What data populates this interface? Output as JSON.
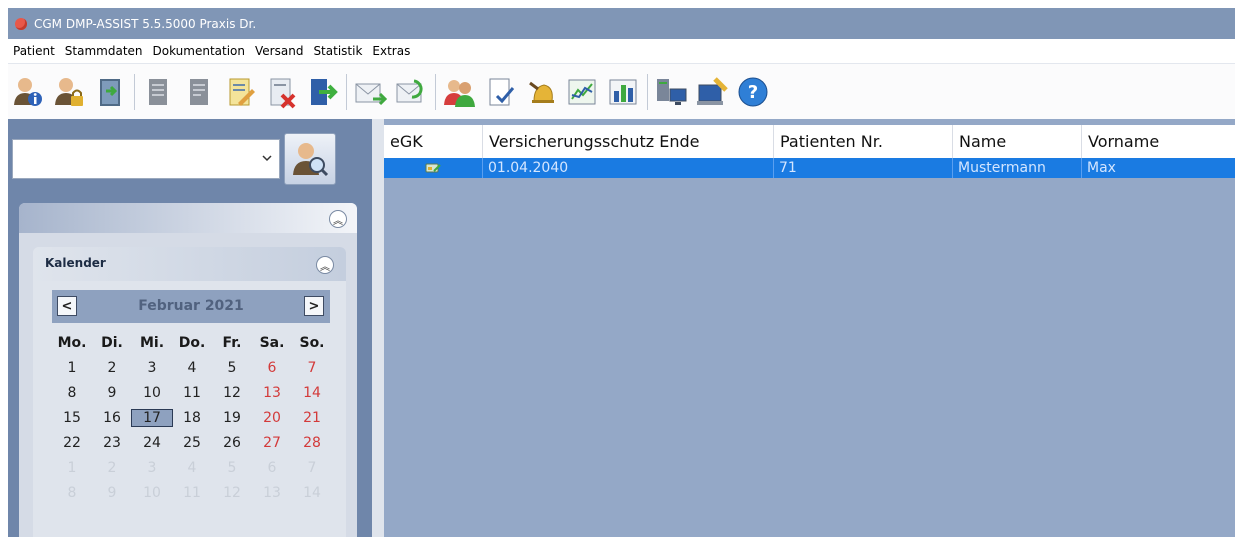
{
  "window": {
    "title": "CGM DMP-ASSIST 5.5.5000 Praxis Dr."
  },
  "menu": [
    "Patient",
    "Stammdaten",
    "Dokumentation",
    "Versand",
    "Statistik",
    "Extras"
  ],
  "toolbar": {
    "icons": [
      "patient-info-icon",
      "patient-lock-icon",
      "door-exit-icon",
      "document-gray-icon",
      "document-gray-2-icon",
      "document-edit-icon",
      "document-delete-icon",
      "exit-arrow-icon",
      "mail-send-icon",
      "mail-refresh-icon",
      "users-icon",
      "document-check-icon",
      "bell-icon",
      "chart-line-icon",
      "chart-bar-icon",
      "server-computer-icon",
      "computer-arm-icon",
      "help-icon"
    ]
  },
  "search": {
    "value": ""
  },
  "calendar": {
    "panel_title": "Kalender",
    "month_label": "Februar 2021",
    "prev_label": "<",
    "next_label": ">",
    "weekdays": [
      "Mo.",
      "Di.",
      "Mi.",
      "Do.",
      "Fr.",
      "Sa.",
      "So."
    ],
    "weeks": [
      [
        "1",
        "2",
        "3",
        "4",
        "5",
        "6",
        "7"
      ],
      [
        "8",
        "9",
        "10",
        "11",
        "12",
        "13",
        "14"
      ],
      [
        "15",
        "16",
        "17",
        "18",
        "19",
        "20",
        "21"
      ],
      [
        "22",
        "23",
        "24",
        "25",
        "26",
        "27",
        "28"
      ],
      [
        "1",
        "2",
        "3",
        "4",
        "5",
        "6",
        "7"
      ],
      [
        "8",
        "9",
        "10",
        "11",
        "12",
        "13",
        "14"
      ]
    ],
    "selected_day": "17"
  },
  "table": {
    "columns": [
      "eGK",
      "Versicherungsschutz Ende",
      "Patienten Nr.",
      "Name",
      "Vorname"
    ],
    "rows": [
      {
        "egk_icon": "card-icon",
        "versicherungsschutz_ende": "01.04.2040",
        "patienten_nr": "71",
        "name": "Mustermann",
        "vorname": "Max"
      }
    ]
  },
  "colors": {
    "selection": "#1a7be2",
    "panel_bg": "#94a8c7",
    "weekend": "#d33a3a"
  }
}
